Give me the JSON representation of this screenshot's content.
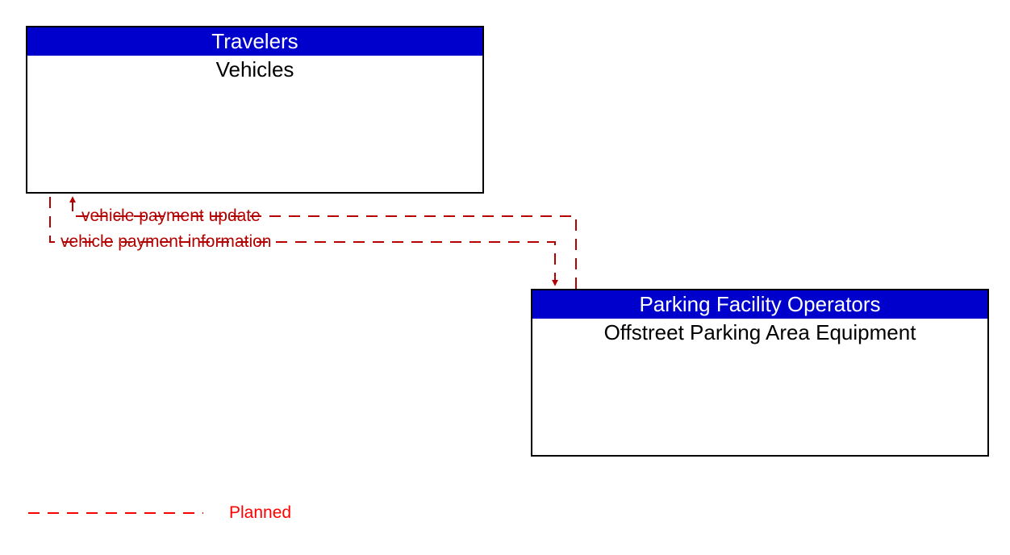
{
  "entities": {
    "travelers": {
      "header": "Travelers",
      "body": "Vehicles"
    },
    "parking": {
      "header": "Parking Facility Operators",
      "body": "Offstreet Parking Area Equipment"
    }
  },
  "flows": {
    "to_vehicles": "vehicle payment update",
    "to_parking": "vehicle payment information"
  },
  "legend": {
    "planned": "Planned"
  },
  "colors": {
    "header_bg": "#0000cc",
    "flow_stroke": "#b30000",
    "legend_stroke": "#ff0000"
  }
}
